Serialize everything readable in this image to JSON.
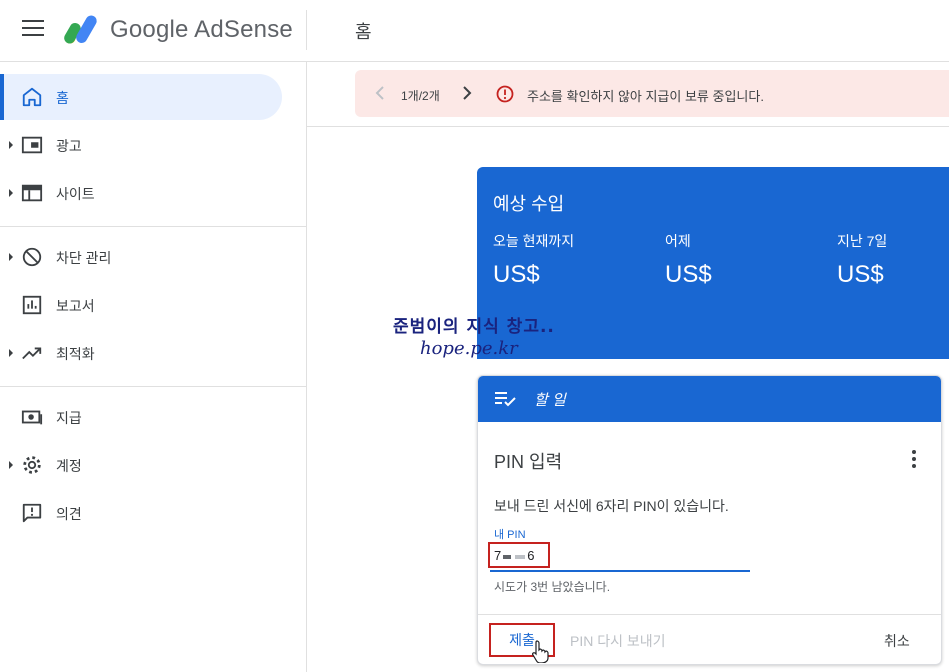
{
  "header": {
    "brand": "Google AdSense",
    "page_title": "홈",
    "menu_icon": "hamburger-menu-icon"
  },
  "sidebar": {
    "items": [
      {
        "label": "홈",
        "icon": "home-icon",
        "active": true,
        "expandable": false
      },
      {
        "label": "광고",
        "icon": "ad-unit-icon",
        "active": false,
        "expandable": true
      },
      {
        "label": "사이트",
        "icon": "web-icon",
        "active": false,
        "expandable": true
      },
      {
        "label": "차단 관리",
        "icon": "block-icon",
        "active": false,
        "expandable": true
      },
      {
        "label": "보고서",
        "icon": "bar-chart-icon",
        "active": false,
        "expandable": false
      },
      {
        "label": "최적화",
        "icon": "trending-up-icon",
        "active": false,
        "expandable": true
      },
      {
        "label": "지급",
        "icon": "payments-icon",
        "active": false,
        "expandable": false
      },
      {
        "label": "계정",
        "icon": "gear-icon",
        "active": false,
        "expandable": true
      },
      {
        "label": "의견",
        "icon": "feedback-icon",
        "active": false,
        "expandable": false
      }
    ]
  },
  "alert": {
    "count": "1개/2개",
    "message": "주소를 확인하지 않아 지급이 보류 중입니다.",
    "icon": "error-icon",
    "background": "#fce8e6"
  },
  "earnings": {
    "title": "예상 수입",
    "columns": [
      {
        "label": "오늘 현재까지",
        "value": "US$"
      },
      {
        "label": "어제",
        "value": "US$"
      },
      {
        "label": "지난 7일",
        "value": "US$"
      }
    ],
    "background": "#1967d2"
  },
  "watermark": {
    "line1": "준범이의 지식 창고..",
    "line2": "hope.pe.kr"
  },
  "todo": {
    "title": "할 일",
    "icon": "playlist-check-icon",
    "card_title": "PIN 입력",
    "description": "보내 드린 서신에 6자리 PIN이 있습니다.",
    "pin_label": "내 PIN",
    "pin_first": "7",
    "pin_last": "6",
    "hint": "시도가 3번 남았습니다.",
    "submit_label": "제출",
    "resend_label": "PIN 다시 보내기",
    "cancel_label": "취소"
  }
}
